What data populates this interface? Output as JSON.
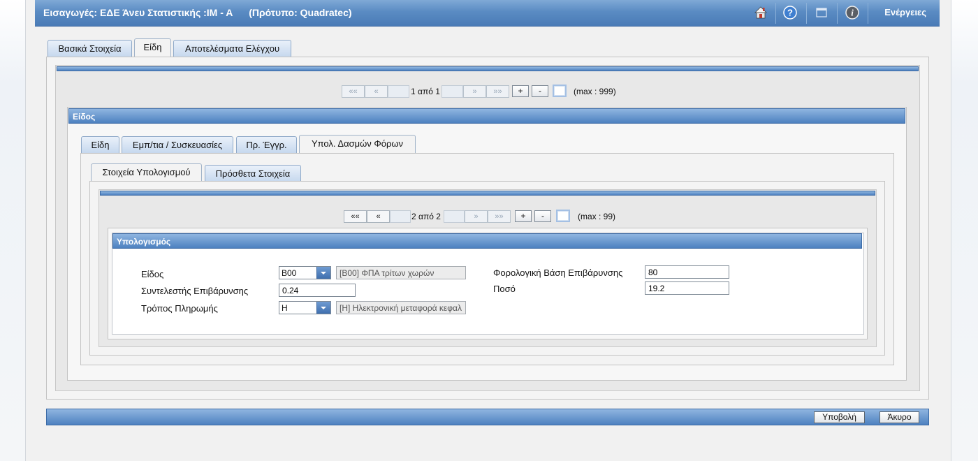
{
  "header": {
    "title": "Εισαγωγές: ΕΔΕ Άνευ Στατιστικής :IM - A      (Πρότυπο: Quadratec)",
    "icons": [
      "home-icon",
      "help-icon",
      "window-icon",
      "info-icon"
    ],
    "actions_label": "Ενέργειες"
  },
  "main_tabs": [
    {
      "label": "Βασικά Στοιχεία",
      "active": false
    },
    {
      "label": "Είδη",
      "active": true
    },
    {
      "label": "Αποτελέσματα Ελέγχου",
      "active": false
    }
  ],
  "outer_pager": {
    "first": "««",
    "prev": "«",
    "status": "1 από 1",
    "next": "»",
    "last": "»»",
    "add": "+",
    "remove": "-",
    "max": "(max : 999)"
  },
  "item_section": {
    "title": "Είδος",
    "tabs": [
      {
        "label": "Είδη",
        "active": false
      },
      {
        "label": "Εμπ/τια / Συσκευασίες",
        "active": false
      },
      {
        "label": "Πρ. Έγγρ.",
        "active": false
      },
      {
        "label": "Υπολ. Δασμών Φόρων",
        "active": true
      }
    ],
    "subtabs": [
      {
        "label": "Στοιχεία Υπολογισμού",
        "active": true
      },
      {
        "label": "Πρόσθετα Στοιχεία",
        "active": false
      }
    ]
  },
  "inner_pager": {
    "first": "««",
    "prev": "«",
    "status": "2 από 2",
    "next": "»",
    "last": "»»",
    "add": "+",
    "remove": "-",
    "max": "(max : 99)"
  },
  "calc": {
    "title": "Υπολογισμός",
    "type_label": "Είδος",
    "type_value": "B00",
    "type_desc": "[B00] ΦΠΑ τρίτων χωρών",
    "rate_label": "Συντελεστής Επιβάρυνσης",
    "rate_value": "0.24",
    "payment_label": "Τρόπος Πληρωμής",
    "payment_value": "H",
    "payment_desc": "[H] Ηλεκτρονική μεταφορά κεφαλ",
    "base_label": "Φορολογική Βάση Επιβάρυνσης",
    "base_value": "80",
    "amount_label": "Ποσό",
    "amount_value": "19.2"
  },
  "footer": {
    "submit": "Υποβολή",
    "cancel": "Άκυρο"
  },
  "colors": {
    "title_bar": "#4a7bb6",
    "section_bar": "#4d81c0"
  }
}
